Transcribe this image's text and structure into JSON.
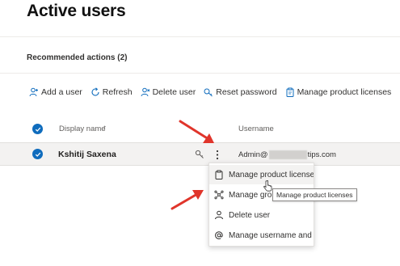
{
  "page": {
    "title": "Active users"
  },
  "recommended": {
    "label": "Recommended actions (2)"
  },
  "toolbar": {
    "items": [
      {
        "label": "Add a user",
        "icon": "person-add-icon"
      },
      {
        "label": "Refresh",
        "icon": "refresh-icon"
      },
      {
        "label": "Delete user",
        "icon": "person-delete-icon"
      },
      {
        "label": "Reset password",
        "icon": "key-icon"
      },
      {
        "label": "Manage product licenses",
        "icon": "license-icon"
      }
    ],
    "more": "···"
  },
  "table": {
    "headers": {
      "display_name": "Display name",
      "sort_indicator": "↑",
      "username": "Username"
    },
    "rows": [
      {
        "display_name": "Kshitij Saxena",
        "username_prefix": "Admin@",
        "username_suffix": "tips.com",
        "selected": true
      }
    ]
  },
  "context_menu": {
    "items": [
      {
        "label": "Manage product licenses",
        "icon": "license-icon",
        "hovered": true
      },
      {
        "label": "Manage groups",
        "icon": "groups-icon",
        "hovered": false
      },
      {
        "label": "Delete user",
        "icon": "person-icon",
        "hovered": false
      },
      {
        "label": "Manage username and email",
        "icon": "at-icon",
        "hovered": false
      }
    ]
  },
  "tooltip": {
    "text": "Manage product licenses"
  },
  "colors": {
    "accent": "#0f6cbd",
    "annotation_arrow": "#e0352b",
    "selected_row": "#f3f2f1"
  }
}
